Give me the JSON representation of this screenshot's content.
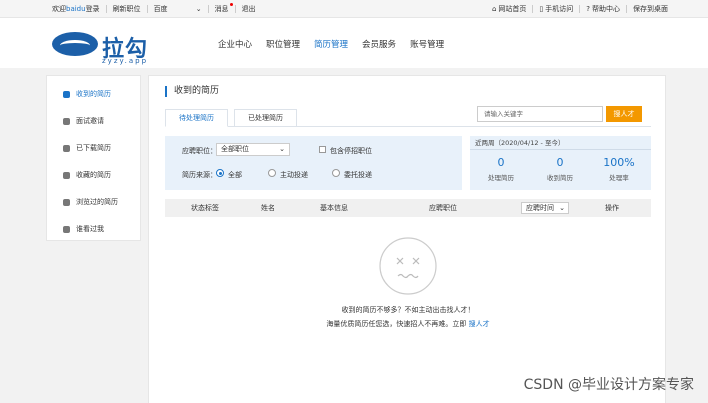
{
  "topbar": {
    "welcome": "欢迎",
    "username": "baidu",
    "login": "登录",
    "refresh_jobs": "刷新职位",
    "dropdown_value": "百度",
    "messages": "消息",
    "logout": "退出",
    "site_home": "网站首页",
    "mobile": "手机访问",
    "help": "帮助中心",
    "save_desktop": "保存到桌面"
  },
  "header": {
    "logo_text": "拉勾",
    "logo_sub": "zyzy.app",
    "nav": [
      "企业中心",
      "职位管理",
      "简历管理",
      "会员服务",
      "账号管理"
    ]
  },
  "sidebar": {
    "items": [
      {
        "label": "收到的简历",
        "icon": "inbox-icon"
      },
      {
        "label": "面试邀请",
        "icon": "calendar-icon"
      },
      {
        "label": "已下载简历",
        "icon": "cloud-download-icon"
      },
      {
        "label": "收藏的简历",
        "icon": "folder-icon"
      },
      {
        "label": "浏览过的简历",
        "icon": "clock-icon"
      },
      {
        "label": "谁看过我",
        "icon": "eye-icon"
      }
    ]
  },
  "main": {
    "title": "收到的简历",
    "tabs": [
      "待处理简历",
      "已处理简历"
    ],
    "search": {
      "placeholder": "请输入关键字",
      "button": "搜人才"
    },
    "filter": {
      "job_label": "应聘职位：",
      "job_value": "全部职位",
      "include_closed": "包含停招职位",
      "source_label": "简历来源：",
      "source_options": [
        "全部",
        "主动投递",
        "委托投递"
      ]
    },
    "stats": {
      "header": "近两周（2020/04/12 - 至今）",
      "items": [
        {
          "value": "0",
          "label": "处理简历"
        },
        {
          "value": "0",
          "label": "收到简历"
        },
        {
          "value": "100%",
          "label": "处理率"
        }
      ]
    },
    "table": {
      "columns": [
        "状态标签",
        "姓名",
        "基本信息",
        "应聘职位",
        "应聘时间",
        "操作"
      ]
    },
    "empty": {
      "line1": "收到的简历不够多？不如主动出击找人才！",
      "line2": "海量优质简历任您选，快速招人不再难。立即",
      "link": "搜人才"
    }
  },
  "watermark": "CSDN @毕业设计方案专家"
}
